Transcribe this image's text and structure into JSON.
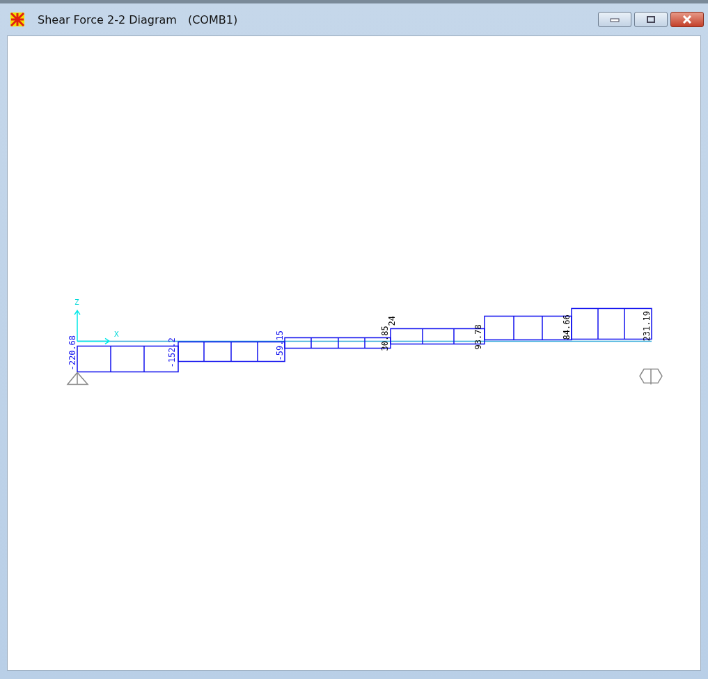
{
  "window": {
    "title": "Shear Force 2-2 Diagram",
    "subtitle": "(COMB1)"
  },
  "diagram": {
    "axes": {
      "vertical": "Z",
      "horizontal": "X"
    },
    "value_labels": [
      "-220.68",
      "-152.2",
      "-59.15",
      "30.85",
      "24",
      "93.78",
      "84.66",
      "231.19"
    ]
  }
}
